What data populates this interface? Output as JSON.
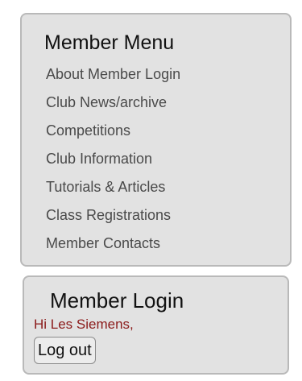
{
  "member_menu": {
    "title": "Member Menu",
    "items": [
      {
        "label": "About Member Login"
      },
      {
        "label": "Club News/archive"
      },
      {
        "label": "Competitions"
      },
      {
        "label": "Club Information"
      },
      {
        "label": "Tutorials & Articles"
      },
      {
        "label": "Class Registrations"
      },
      {
        "label": "Member Contacts"
      }
    ]
  },
  "member_login": {
    "title": "Member Login",
    "greeting": "Hi Les Siemens,",
    "logout_label": "Log out"
  },
  "colors": {
    "panel_background": "#e2e2e2",
    "panel_border": "#b9b9b9",
    "link_text": "#4a4a4a",
    "greeting_text": "#8b1a1a"
  }
}
